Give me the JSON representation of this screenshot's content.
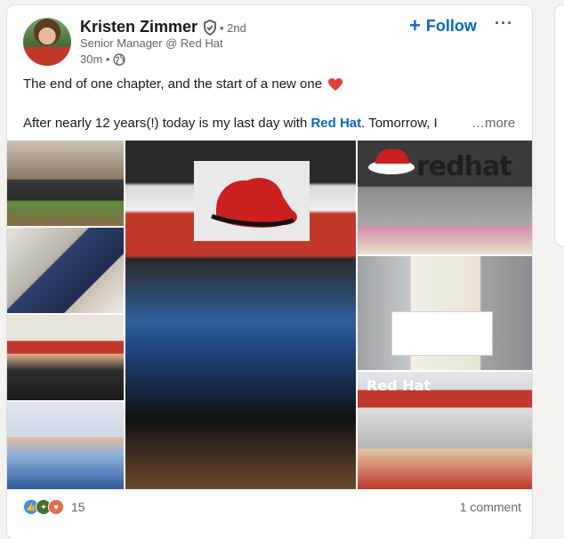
{
  "post": {
    "author_name": "Kristen Zimmer",
    "degree": "• 2nd",
    "headline": "Senior Manager @ Red Hat",
    "time": "30m •",
    "follow_label": "Follow",
    "more_menu": "···",
    "text_line1": "The end of one chapter, and the start of a new one",
    "text_line2_prefix": "After nearly 12 years(!) today is my last day with ",
    "text_line2_link": "Red Hat",
    "text_line2_suffix": ". Tomorrow, I",
    "see_more": "…more",
    "brand_word": "redhat",
    "sign_text": "Red Hat"
  },
  "social": {
    "reaction_count": "15",
    "comments": "1 comment"
  },
  "icons": {
    "verified": "verified-shield-icon",
    "globe": "globe-icon",
    "heart": "red-heart-emoji-icon",
    "like": "like-reaction-icon",
    "celebrate": "celebrate-reaction-icon",
    "love": "love-reaction-icon"
  },
  "colors": {
    "link": "#0a66c2",
    "text": "#191919",
    "muted": "#666666",
    "brand_red": "#c0392b"
  }
}
